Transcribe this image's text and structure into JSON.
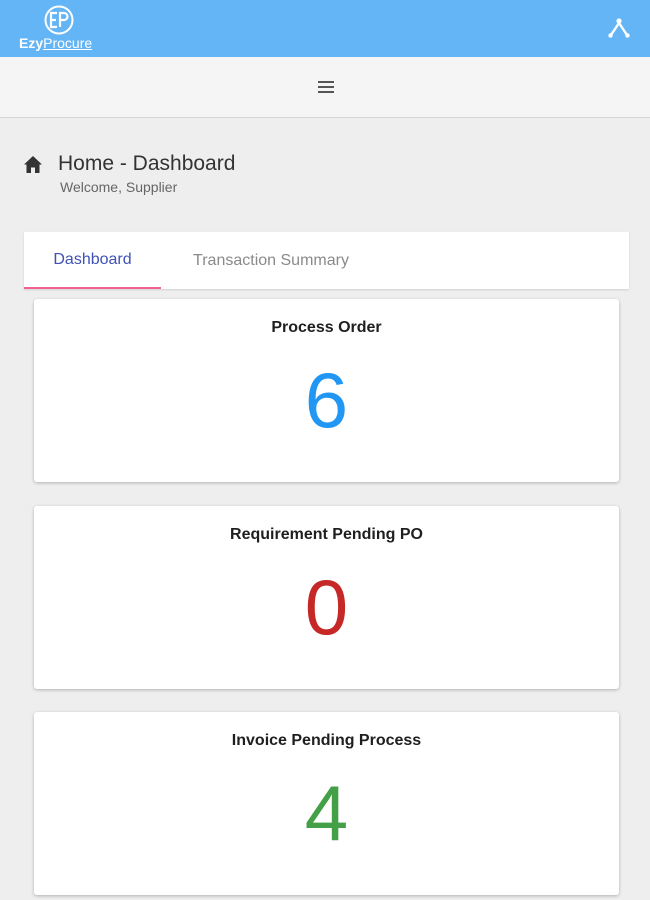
{
  "header": {
    "logo_text_bold": "Ezy",
    "logo_text_rest": "Procure",
    "logo_icon": "ezyprocure-logo-icon",
    "profile_icon": "profile-menu-icon",
    "background_color": "#64b5f6"
  },
  "toolbar": {
    "menu_icon": "hamburger-menu-icon"
  },
  "page": {
    "title": "Home - Dashboard",
    "subtitle": "Welcome, Supplier",
    "title_icon": "home-icon"
  },
  "tabs": [
    {
      "label": "Dashboard",
      "active": true
    },
    {
      "label": "Transaction Summary",
      "active": false
    }
  ],
  "cards": [
    {
      "title": "Process Order",
      "value": "6",
      "color": "#2196f3"
    },
    {
      "title": "Requirement Pending PO",
      "value": "0",
      "color": "#c62828"
    },
    {
      "title": "Invoice Pending Process",
      "value": "4",
      "color": "#43a047"
    }
  ]
}
